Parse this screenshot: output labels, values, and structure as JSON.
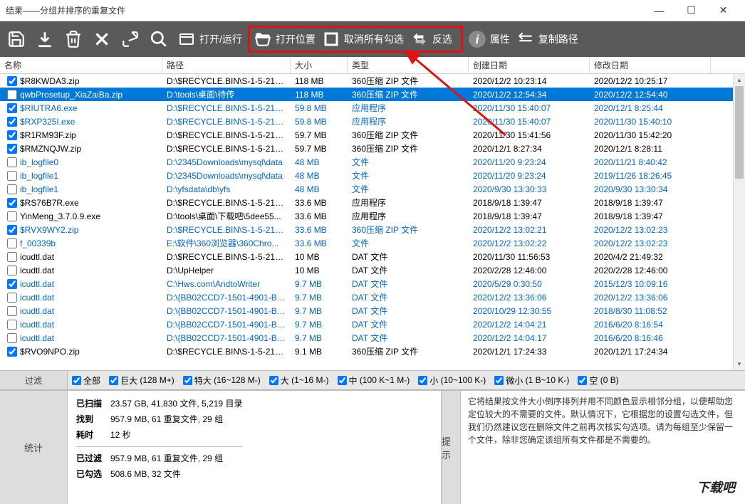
{
  "window": {
    "title": "结果——分组并排序的重复文件"
  },
  "toolbar": {
    "open_run": "打开/运行",
    "open_location": "打开位置",
    "uncheck_all": "取消所有勾选",
    "invert": "反选",
    "properties": "属性",
    "copy_path": "复制路径"
  },
  "columns": {
    "name": "名称",
    "path": "路径",
    "size": "大小",
    "type": "类型",
    "created": "创建日期",
    "modified": "修改日期"
  },
  "rows": [
    {
      "checked": true,
      "name": "$R8KWDA3.zip",
      "path": "D:\\$RECYCLE.BIN\\S-1-5-21-21...",
      "size": "118 MB",
      "type": "360压缩 ZIP 文件",
      "created": "2020/12/2 10:23:14",
      "modified": "2020/12/2 10:25:17",
      "group": 0,
      "sel": false
    },
    {
      "checked": false,
      "name": "qwbProsetup_XiaZaiBa.zip",
      "path": "D:\\tools\\桌面\\待传",
      "size": "118 MB",
      "type": "360压缩 ZIP 文件",
      "created": "2020/12/2 12:54:34",
      "modified": "2020/12/2 12:54:40",
      "group": 0,
      "sel": true
    },
    {
      "checked": true,
      "name": "$RIUTRA6.exe",
      "path": "D:\\$RECYCLE.BIN\\S-1-5-21-21...",
      "size": "59.8 MB",
      "type": "应用程序",
      "created": "2020/11/30 15:40:07",
      "modified": "2020/12/1 8:25:44",
      "group": 1,
      "sel": false
    },
    {
      "checked": true,
      "name": "$RXP325I.exe",
      "path": "D:\\$RECYCLE.BIN\\S-1-5-21-21...",
      "size": "59.8 MB",
      "type": "应用程序",
      "created": "2020/11/30 15:40:07",
      "modified": "2020/11/30 15:40:10",
      "group": 1,
      "sel": false
    },
    {
      "checked": true,
      "name": "$R1RM93F.zip",
      "path": "D:\\$RECYCLE.BIN\\S-1-5-21-21...",
      "size": "59.7 MB",
      "type": "360压缩 ZIP 文件",
      "created": "2020/11/30 15:41:56",
      "modified": "2020/11/30 15:42:20",
      "group": 2,
      "sel": false
    },
    {
      "checked": true,
      "name": "$RMZNQJW.zip",
      "path": "D:\\$RECYCLE.BIN\\S-1-5-21-21...",
      "size": "59.7 MB",
      "type": "360压缩 ZIP 文件",
      "created": "2020/12/1 8:27:34",
      "modified": "2020/12/1 8:28:11",
      "group": 2,
      "sel": false
    },
    {
      "checked": false,
      "name": "ib_logfile0",
      "path": "D:\\2345Downloads\\mysql\\data",
      "size": "48 MB",
      "type": "文件",
      "created": "2020/11/20 9:23:24",
      "modified": "2020/11/21 8:40:42",
      "group": 3,
      "sel": false
    },
    {
      "checked": false,
      "name": "ib_logfile1",
      "path": "D:\\2345Downloads\\mysql\\data",
      "size": "48 MB",
      "type": "文件",
      "created": "2020/11/20 9:23:24",
      "modified": "2019/11/26 18:26:45",
      "group": 3,
      "sel": false
    },
    {
      "checked": false,
      "name": "ib_logfile1",
      "path": "D:\\yfsdata\\db\\yfs",
      "size": "48 MB",
      "type": "文件",
      "created": "2020/9/30 13:30:33",
      "modified": "2020/9/30 13:30:34",
      "group": 3,
      "sel": false
    },
    {
      "checked": true,
      "name": "$RS76B7R.exe",
      "path": "D:\\$RECYCLE.BIN\\S-1-5-21-21...",
      "size": "33.6 MB",
      "type": "应用程序",
      "created": "2018/9/18 1:39:47",
      "modified": "2018/9/18 1:39:47",
      "group": 4,
      "sel": false
    },
    {
      "checked": false,
      "name": "YinMeng_3.7.0.9.exe",
      "path": "D:\\tools\\桌面\\下载吧\\5dee55...",
      "size": "33.6 MB",
      "type": "应用程序",
      "created": "2018/9/18 1:39:47",
      "modified": "2018/9/18 1:39:47",
      "group": 4,
      "sel": false
    },
    {
      "checked": true,
      "name": "$RVX9WY2.zip",
      "path": "D:\\$RECYCLE.BIN\\S-1-5-21-21...",
      "size": "33.6 MB",
      "type": "360压缩 ZIP 文件",
      "created": "2020/12/2 13:02:21",
      "modified": "2020/12/2 13:02:23",
      "group": 5,
      "sel": false
    },
    {
      "checked": false,
      "name": "f_00339b",
      "path": "E:\\软件\\360浏览器\\360Chro...",
      "size": "33.6 MB",
      "type": "文件",
      "created": "2020/12/2 13:02:22",
      "modified": "2020/12/2 13:02:23",
      "group": 5,
      "sel": false
    },
    {
      "checked": false,
      "name": "icudtl.dat",
      "path": "D:\\$RECYCLE.BIN\\S-1-5-21-21...",
      "size": "10 MB",
      "type": "DAT 文件",
      "created": "2020/11/30 11:56:53",
      "modified": "2020/4/2 21:49:32",
      "group": 6,
      "sel": false
    },
    {
      "checked": false,
      "name": "icudtl.dat",
      "path": "D:\\UpHelper",
      "size": "10 MB",
      "type": "DAT 文件",
      "created": "2020/2/28 12:46:00",
      "modified": "2020/2/28 12:46:00",
      "group": 6,
      "sel": false
    },
    {
      "checked": true,
      "name": "icudtl.dat",
      "path": "C:\\Hws.com\\AndtoWriter",
      "size": "9.7 MB",
      "type": "DAT 文件",
      "created": "2020/5/29 0:30:50",
      "modified": "2015/12/3 10:09:16",
      "group": 7,
      "sel": false
    },
    {
      "checked": false,
      "name": "icudtl.dat",
      "path": "D:\\{BB02CCD7-1501-4901-B5E...",
      "size": "9.7 MB",
      "type": "DAT 文件",
      "created": "2020/12/2 13:36:06",
      "modified": "2020/12/2 13:36:06",
      "group": 7,
      "sel": false
    },
    {
      "checked": false,
      "name": "icudtl.dat",
      "path": "D:\\{BB02CCD7-1501-4901-B5E...",
      "size": "9.7 MB",
      "type": "DAT 文件",
      "created": "2020/10/29 12:30:55",
      "modified": "2018/8/30 11:08:52",
      "group": 7,
      "sel": false
    },
    {
      "checked": false,
      "name": "icudtl.dat",
      "path": "D:\\{BB02CCD7-1501-4901-B5E...",
      "size": "9.7 MB",
      "type": "DAT 文件",
      "created": "2020/12/2 14:04:21",
      "modified": "2016/6/20 8:16:54",
      "group": 7,
      "sel": false
    },
    {
      "checked": false,
      "name": "icudtl.dat",
      "path": "D:\\{BB02CCD7-1501-4901-B5E...",
      "size": "9.7 MB",
      "type": "DAT 文件",
      "created": "2020/12/2 14:04:17",
      "modified": "2016/6/20 8:16:46",
      "group": 7,
      "sel": false
    },
    {
      "checked": true,
      "name": "$RVO9NPO.zip",
      "path": "D:\\$RECYCLE.BIN\\S-1-5-21-21...",
      "size": "9.1 MB",
      "type": "360压缩 ZIP 文件",
      "created": "2020/12/1 17:24:33",
      "modified": "2020/12/1 17:24:34",
      "group": 8,
      "sel": false
    }
  ],
  "filters": {
    "label": "过滤",
    "all": "全部",
    "huge": "巨大",
    "huge_range": "(128 M+)",
    "xlarge": "特大",
    "xlarge_range": "(16~128 M-)",
    "large": "大",
    "large_range": "(1~16 M-)",
    "medium": "中",
    "medium_range": "(100 K~1 M-)",
    "small": "小",
    "small_range": "(10~100 K-)",
    "tiny": "微小",
    "tiny_range": "(1 B~10 K-)",
    "empty": "空",
    "empty_range": "(0 B)"
  },
  "stats": {
    "label": "统计",
    "scanned_key": "已扫描",
    "scanned_val": "23.57 GB, 41,830 文件, 5,219 目录",
    "found_key": "找到",
    "found_val": "957.9 MB, 61 重复文件, 29 组",
    "time_key": "耗时",
    "time_val": "12 秒",
    "filtered_key": "已过滤",
    "filtered_val": "957.9 MB, 61 重复文件, 29 组",
    "checked_key": "已勾选",
    "checked_val": "508.6 MB, 32 文件"
  },
  "tip": {
    "label": "提示",
    "text": "它将结果按文件大小倒序排列并用不同颜色显示相邻分组，以便帮助您定位较大的不需要的文件。默认情况下，它根据您的设置勾选文件，但我们仍然建议您在删除文件之前再次核实勾选项。请为每组至少保留一个文件，除非您确定该组所有文件都是不需要的。"
  },
  "watermark": "下载吧"
}
